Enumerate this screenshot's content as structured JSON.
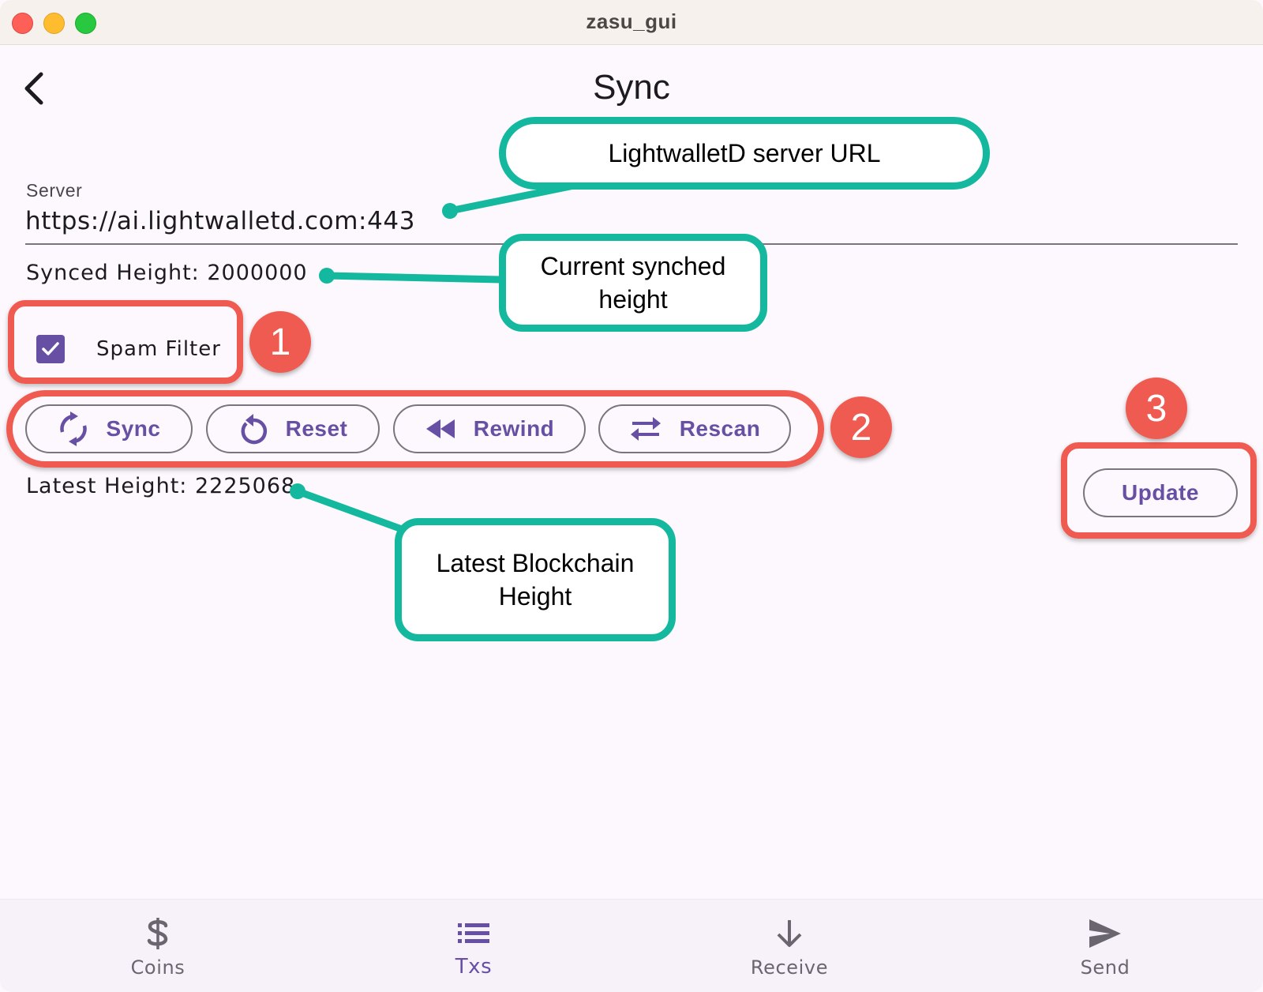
{
  "window": {
    "title": "zasu_gui"
  },
  "page": {
    "title": "Sync"
  },
  "server": {
    "label": "Server",
    "value": "https://ai.lightwalletd.com:443"
  },
  "synced_height": {
    "label": "Synced Height:",
    "value": "2000000"
  },
  "spam_filter": {
    "label": "Spam Filter",
    "checked": true
  },
  "actions": {
    "sync": "Sync",
    "reset": "Reset",
    "rewind": "Rewind",
    "rescan": "Rescan",
    "update": "Update"
  },
  "latest_height": {
    "label": "Latest Height:",
    "value": "2225068"
  },
  "annotations": {
    "server_url": "LightwalletD server URL",
    "current_synched_height": [
      "Current synched",
      "height"
    ],
    "latest_blockchain_height": [
      "Latest Blockchain",
      "Height"
    ],
    "badges": [
      "1",
      "2",
      "3"
    ]
  },
  "bottom_nav": {
    "items": [
      {
        "label": "Coins",
        "icon": "dollar-icon",
        "active": false
      },
      {
        "label": "Txs",
        "icon": "list-icon",
        "active": true
      },
      {
        "label": "Receive",
        "icon": "arrow-down-icon",
        "active": false
      },
      {
        "label": "Send",
        "icon": "send-icon",
        "active": false
      }
    ]
  },
  "colors": {
    "accent": "#6750a4",
    "annotation_green": "#13b89f",
    "annotation_red": "#ef5b50",
    "background": "#fdf8fd"
  }
}
